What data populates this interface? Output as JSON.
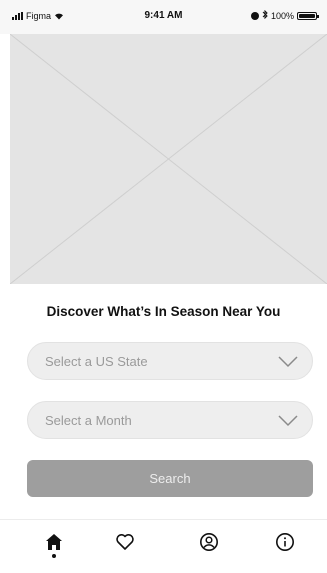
{
  "status_bar": {
    "carrier": "Figma",
    "time": "9:41 AM",
    "battery": "100%",
    "battery_level": 1.0
  },
  "hero": {
    "image_icon": "image-placeholder"
  },
  "headline": "Discover What’s In Season Near You",
  "state_select": {
    "placeholder": "Select a US State",
    "icon": "chevron-down-icon"
  },
  "month_select": {
    "placeholder": "Select a Month",
    "icon": "chevron-down-icon"
  },
  "search_button": {
    "label": "Search"
  },
  "tab_bar": {
    "items": [
      {
        "name": "home",
        "icon": "home-icon",
        "active": true
      },
      {
        "name": "favorites",
        "icon": "heart-icon",
        "active": false
      },
      {
        "name": "profile",
        "icon": "user-circle-icon",
        "active": false
      },
      {
        "name": "info",
        "icon": "info-icon",
        "active": false
      }
    ]
  },
  "colors": {
    "placeholder_bg": "#e4e4e4",
    "select_bg": "#eeeeee",
    "button_bg": "#9e9e9e",
    "text": "#111111",
    "muted_text": "#9a9a9a"
  }
}
